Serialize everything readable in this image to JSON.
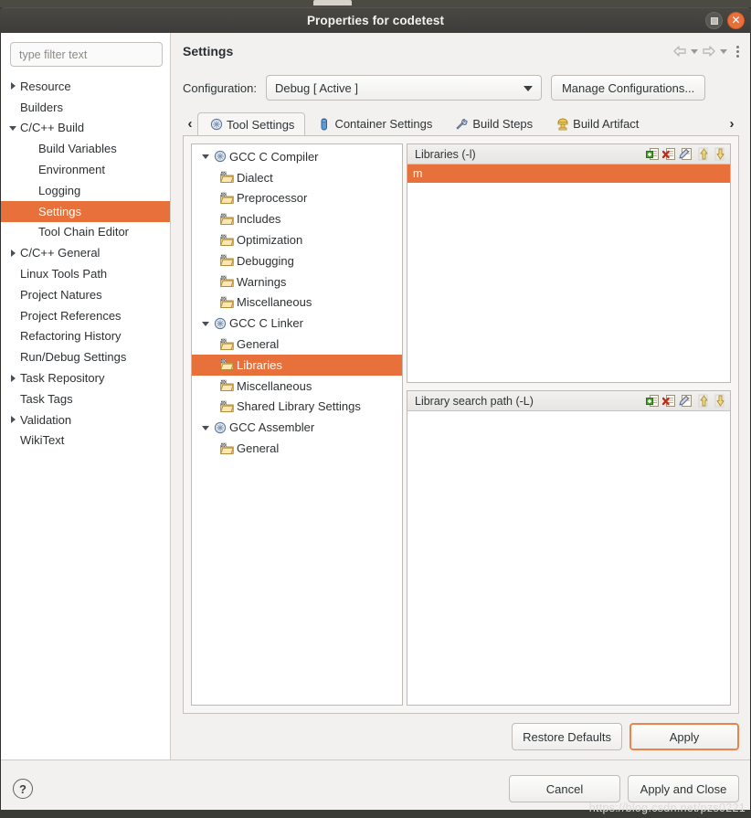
{
  "window": {
    "title": "Properties for codetest",
    "buttons": {
      "restore": "restore",
      "close": "close"
    }
  },
  "navpane": {
    "filter_placeholder": "type filter text",
    "filter_value": "",
    "items": [
      {
        "label": "Resource",
        "level": 1,
        "twisty": "collapsed",
        "selected": false
      },
      {
        "label": "Builders",
        "level": 1,
        "twisty": "none",
        "selected": false
      },
      {
        "label": "C/C++ Build",
        "level": 1,
        "twisty": "expanded",
        "selected": false
      },
      {
        "label": "Build Variables",
        "level": 2,
        "twisty": "none",
        "selected": false
      },
      {
        "label": "Environment",
        "level": 2,
        "twisty": "none",
        "selected": false
      },
      {
        "label": "Logging",
        "level": 2,
        "twisty": "none",
        "selected": false
      },
      {
        "label": "Settings",
        "level": 2,
        "twisty": "none",
        "selected": true
      },
      {
        "label": "Tool Chain Editor",
        "level": 2,
        "twisty": "none",
        "selected": false
      },
      {
        "label": "C/C++ General",
        "level": 1,
        "twisty": "collapsed",
        "selected": false
      },
      {
        "label": "Linux Tools Path",
        "level": 1,
        "twisty": "none",
        "selected": false
      },
      {
        "label": "Project Natures",
        "level": 1,
        "twisty": "none",
        "selected": false
      },
      {
        "label": "Project References",
        "level": 1,
        "twisty": "none",
        "selected": false
      },
      {
        "label": "Refactoring History",
        "level": 1,
        "twisty": "none",
        "selected": false
      },
      {
        "label": "Run/Debug Settings",
        "level": 1,
        "twisty": "none",
        "selected": false
      },
      {
        "label": "Task Repository",
        "level": 1,
        "twisty": "collapsed",
        "selected": false
      },
      {
        "label": "Task Tags",
        "level": 1,
        "twisty": "none",
        "selected": false
      },
      {
        "label": "Validation",
        "level": 1,
        "twisty": "collapsed",
        "selected": false
      },
      {
        "label": "WikiText",
        "level": 1,
        "twisty": "none",
        "selected": false
      }
    ]
  },
  "content": {
    "title": "Settings",
    "header_tools": [
      {
        "name": "back-arrow-icon"
      },
      {
        "name": "back-dropdown-icon"
      },
      {
        "name": "forward-arrow-icon"
      },
      {
        "name": "forward-dropdown-icon"
      },
      {
        "name": "view-menu-icon"
      }
    ],
    "configuration": {
      "label": "Configuration:",
      "selected": "Debug  [ Active ]",
      "manage_button": "Manage Configurations..."
    },
    "tabs": [
      {
        "label": "Tool Settings",
        "icon": "tool-settings-icon",
        "active": true
      },
      {
        "label": "Container Settings",
        "icon": "container-settings-icon",
        "active": false
      },
      {
        "label": "Build Steps",
        "icon": "build-steps-icon",
        "active": false
      },
      {
        "label": "Build Artifact",
        "icon": "build-artifact-icon",
        "active": false
      }
    ],
    "tab_scroll_left": "‹",
    "tab_scroll_right": "›"
  },
  "tool_tree": [
    {
      "label": "GCC C Compiler",
      "level": 1,
      "icon": "tool-icon",
      "twisty": "expanded",
      "selected": false
    },
    {
      "label": "Dialect",
      "level": 2,
      "icon": "folder-icon",
      "twisty": "none",
      "selected": false
    },
    {
      "label": "Preprocessor",
      "level": 2,
      "icon": "folder-icon",
      "twisty": "none",
      "selected": false
    },
    {
      "label": "Includes",
      "level": 2,
      "icon": "folder-icon",
      "twisty": "none",
      "selected": false
    },
    {
      "label": "Optimization",
      "level": 2,
      "icon": "folder-icon",
      "twisty": "none",
      "selected": false
    },
    {
      "label": "Debugging",
      "level": 2,
      "icon": "folder-icon",
      "twisty": "none",
      "selected": false
    },
    {
      "label": "Warnings",
      "level": 2,
      "icon": "folder-icon",
      "twisty": "none",
      "selected": false
    },
    {
      "label": "Miscellaneous",
      "level": 2,
      "icon": "folder-icon",
      "twisty": "none",
      "selected": false
    },
    {
      "label": "GCC C Linker",
      "level": 1,
      "icon": "tool-icon",
      "twisty": "expanded",
      "selected": false
    },
    {
      "label": "General",
      "level": 2,
      "icon": "folder-icon",
      "twisty": "none",
      "selected": false
    },
    {
      "label": "Libraries",
      "level": 2,
      "icon": "folder-icon",
      "twisty": "none",
      "selected": true
    },
    {
      "label": "Miscellaneous",
      "level": 2,
      "icon": "folder-icon",
      "twisty": "none",
      "selected": false
    },
    {
      "label": "Shared Library Settings",
      "level": 2,
      "icon": "folder-icon",
      "twisty": "none",
      "selected": false
    },
    {
      "label": "GCC Assembler",
      "level": 1,
      "icon": "tool-icon",
      "twisty": "expanded",
      "selected": false
    },
    {
      "label": "General",
      "level": 2,
      "icon": "folder-icon",
      "twisty": "none",
      "selected": false
    }
  ],
  "panels": {
    "libraries": {
      "title": "Libraries (-l)",
      "tools": [
        "add-icon",
        "delete-icon",
        "edit-icon",
        "move-up-icon",
        "move-down-icon"
      ],
      "items": [
        {
          "value": "m",
          "selected": true
        }
      ]
    },
    "library_search_path": {
      "title": "Library search path (-L)",
      "tools": [
        "add-icon",
        "delete-icon",
        "edit-icon",
        "move-up-icon",
        "move-down-icon"
      ],
      "items": []
    }
  },
  "apply_bar": {
    "restore_defaults": "Restore Defaults",
    "apply": "Apply"
  },
  "bottom_bar": {
    "help": "?",
    "cancel": "Cancel",
    "apply_and_close": "Apply and Close"
  },
  "watermark": "https://blog.csdn.net/pzs0221",
  "colors": {
    "selection": "#e8703a",
    "titlebar": "#443f3a",
    "window_bg": "#f2f1f0",
    "close_button": "#e8703a"
  }
}
